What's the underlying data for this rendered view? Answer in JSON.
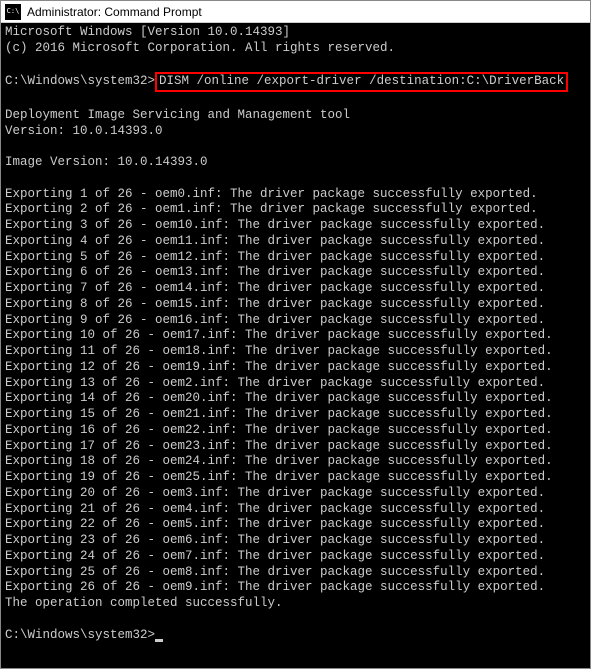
{
  "titlebar": {
    "title": "Administrator: Command Prompt"
  },
  "header": {
    "line1": "Microsoft Windows [Version 10.0.14393]",
    "line2": "(c) 2016 Microsoft Corporation. All rights reserved."
  },
  "prompt1": {
    "path": "C:\\Windows\\system32>",
    "command": "DISM /online /export-driver /destination:C:\\DriverBack"
  },
  "tool": {
    "line1": "Deployment Image Servicing and Management tool",
    "line2": "Version: 10.0.14393.0"
  },
  "image_version": "Image Version: 10.0.14393.0",
  "exports": [
    "Exporting 1 of 26 - oem0.inf: The driver package successfully exported.",
    "Exporting 2 of 26 - oem1.inf: The driver package successfully exported.",
    "Exporting 3 of 26 - oem10.inf: The driver package successfully exported.",
    "Exporting 4 of 26 - oem11.inf: The driver package successfully exported.",
    "Exporting 5 of 26 - oem12.inf: The driver package successfully exported.",
    "Exporting 6 of 26 - oem13.inf: The driver package successfully exported.",
    "Exporting 7 of 26 - oem14.inf: The driver package successfully exported.",
    "Exporting 8 of 26 - oem15.inf: The driver package successfully exported.",
    "Exporting 9 of 26 - oem16.inf: The driver package successfully exported.",
    "Exporting 10 of 26 - oem17.inf: The driver package successfully exported.",
    "Exporting 11 of 26 - oem18.inf: The driver package successfully exported.",
    "Exporting 12 of 26 - oem19.inf: The driver package successfully exported.",
    "Exporting 13 of 26 - oem2.inf: The driver package successfully exported.",
    "Exporting 14 of 26 - oem20.inf: The driver package successfully exported.",
    "Exporting 15 of 26 - oem21.inf: The driver package successfully exported.",
    "Exporting 16 of 26 - oem22.inf: The driver package successfully exported.",
    "Exporting 17 of 26 - oem23.inf: The driver package successfully exported.",
    "Exporting 18 of 26 - oem24.inf: The driver package successfully exported.",
    "Exporting 19 of 26 - oem25.inf: The driver package successfully exported.",
    "Exporting 20 of 26 - oem3.inf: The driver package successfully exported.",
    "Exporting 21 of 26 - oem4.inf: The driver package successfully exported.",
    "Exporting 22 of 26 - oem5.inf: The driver package successfully exported.",
    "Exporting 23 of 26 - oem6.inf: The driver package successfully exported.",
    "Exporting 24 of 26 - oem7.inf: The driver package successfully exported.",
    "Exporting 25 of 26 - oem8.inf: The driver package successfully exported.",
    "Exporting 26 of 26 - oem9.inf: The driver package successfully exported."
  ],
  "completion": "The operation completed successfully.",
  "prompt2": {
    "path": "C:\\Windows\\system32>"
  }
}
